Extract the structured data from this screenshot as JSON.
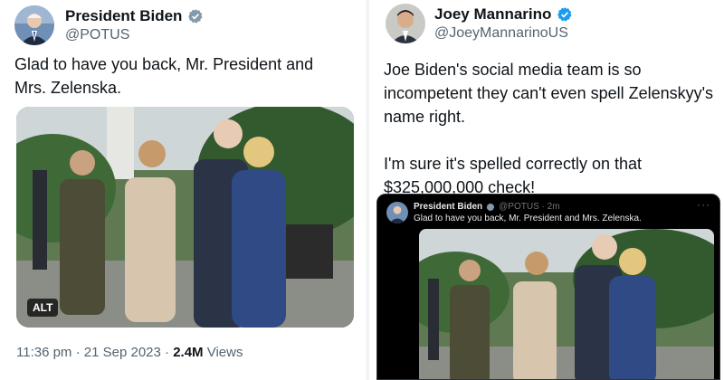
{
  "left_tweet": {
    "display_name": "President Biden",
    "handle": "@POTUS",
    "text": "Glad to have you back, Mr. President and Mrs. Zelenska.",
    "alt_badge": "ALT",
    "time": "11:36 pm",
    "date": "21 Sep 2023",
    "views_count": "2.4M",
    "views_label": "Views"
  },
  "right_tweet": {
    "display_name": "Joey Mannarino",
    "handle": "@JoeyMannarinoUS",
    "text": "Joe Biden's social media team is so incompetent they can't even spell Zelenskyy's name right.\n\nI'm sure it's spelled correctly on that $325,000,000 check!"
  },
  "embedded_tweet": {
    "display_name": "President Biden",
    "handle_time": "@POTUS · 2m",
    "text": "Glad to have you back, Mr. President and Mrs. Zelenska.",
    "more_icon": "more-dots-icon"
  },
  "colors": {
    "verified_blue": "#1d9bf0",
    "secondary_text": "#536471",
    "primary_text": "#0f1419"
  }
}
